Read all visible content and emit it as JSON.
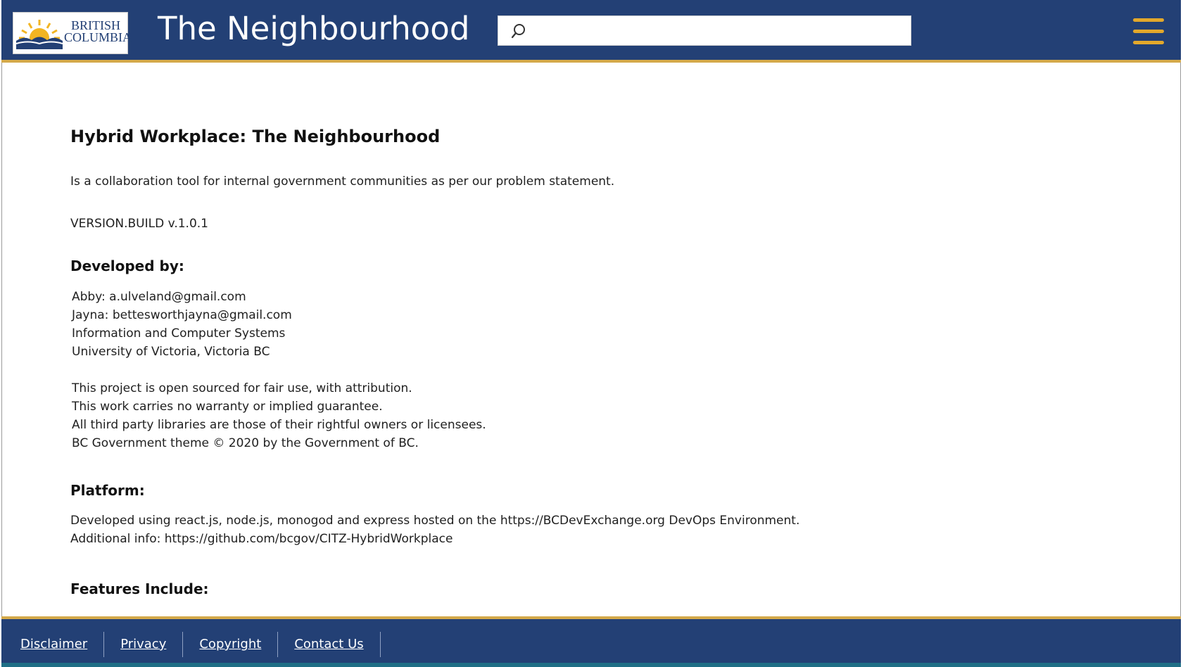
{
  "header": {
    "logo": {
      "line1": "BRITISH",
      "line2": "COLUMBIA"
    },
    "title": "The Neighbourhood",
    "search": {
      "value": "",
      "placeholder": ""
    },
    "menu_icon": "hamburger-menu-icon"
  },
  "main": {
    "title": "Hybrid Workplace: The Neighbourhood",
    "description": "Is a collaboration tool for internal government communities as per our problem statement.",
    "version": "VERSION.BUILD v.1.0.1",
    "developed_heading": "Developed by:",
    "developers": [
      "Abby: a.ulveland@gmail.com",
      "Jayna: bettesworthjayna@gmail.com",
      "Information and Computer Systems",
      "University of Victoria, Victoria BC"
    ],
    "notices": [
      "This project is open sourced for fair use, with attribution.",
      "This work carries no warranty or implied guarantee.",
      "All third party libraries are those of their rightful owners or licensees.",
      "BC Government theme © 2020 by the Government of BC."
    ],
    "platform_heading": "Platform:",
    "platform": [
      "Developed using react.js, node.js, monogod and express hosted on the https://BCDevExchange.org DevOps Environment.",
      "Additional info: https://github.com/bcgov/CITZ-HybridWorkplace"
    ],
    "features_heading": "Features Include:"
  },
  "footer": {
    "links": [
      "Disclaimer",
      "Privacy",
      "Copyright",
      "Contact Us"
    ]
  },
  "colors": {
    "header_bg": "#234075",
    "accent_gold": "#d4a94a",
    "menu_icon": "#e3a82b"
  }
}
